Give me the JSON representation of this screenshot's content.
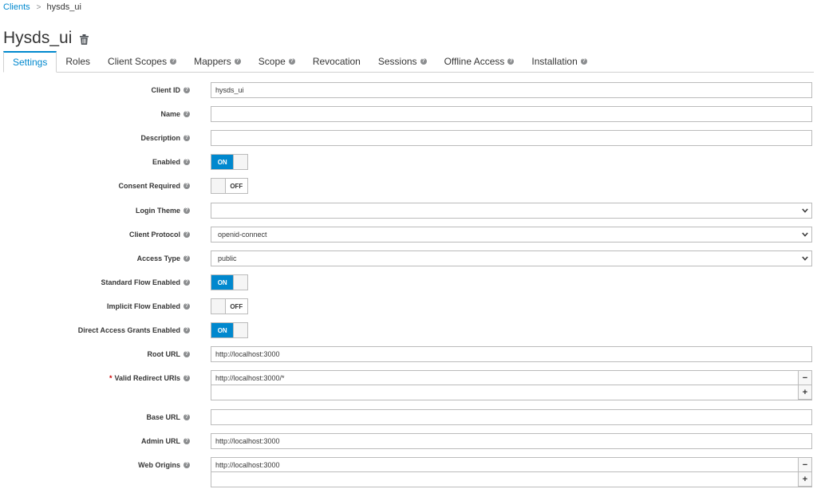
{
  "breadcrumb": {
    "parent": "Clients",
    "separator": ">",
    "current": "hysds_ui"
  },
  "title": "Hysds_ui",
  "tabs": [
    {
      "label": "Settings",
      "help": false
    },
    {
      "label": "Roles",
      "help": false
    },
    {
      "label": "Client Scopes",
      "help": true
    },
    {
      "label": "Mappers",
      "help": true
    },
    {
      "label": "Scope",
      "help": true
    },
    {
      "label": "Revocation",
      "help": false
    },
    {
      "label": "Sessions",
      "help": true
    },
    {
      "label": "Offline Access",
      "help": true
    },
    {
      "label": "Installation",
      "help": true
    }
  ],
  "form": {
    "client_id": {
      "label": "Client ID",
      "value": "hysds_ui"
    },
    "name": {
      "label": "Name",
      "value": ""
    },
    "description": {
      "label": "Description",
      "value": ""
    },
    "enabled": {
      "label": "Enabled",
      "state": "ON"
    },
    "consent_required": {
      "label": "Consent Required",
      "state": "OFF"
    },
    "login_theme": {
      "label": "Login Theme",
      "value": ""
    },
    "client_protocol": {
      "label": "Client Protocol",
      "value": "openid-connect"
    },
    "access_type": {
      "label": "Access Type",
      "value": "public"
    },
    "standard_flow": {
      "label": "Standard Flow Enabled",
      "state": "ON"
    },
    "implicit_flow": {
      "label": "Implicit Flow Enabled",
      "state": "OFF"
    },
    "direct_access": {
      "label": "Direct Access Grants Enabled",
      "state": "ON"
    },
    "root_url": {
      "label": "Root URL",
      "value": "http://localhost:3000"
    },
    "valid_redirect": {
      "label": "Valid Redirect URIs",
      "required_mark": "*",
      "values": [
        "http://localhost:3000/*",
        ""
      ]
    },
    "base_url": {
      "label": "Base URL",
      "value": ""
    },
    "admin_url": {
      "label": "Admin URL",
      "value": "http://localhost:3000"
    },
    "web_origins": {
      "label": "Web Origins",
      "values": [
        "http://localhost:3000",
        ""
      ]
    }
  },
  "icons": {
    "help": "question-circle-icon",
    "trash": "trash-icon",
    "chevron": "chevron-down-icon",
    "remove": "minus-icon",
    "add": "plus-icon"
  },
  "buttons": {
    "minus": "−",
    "plus": "+"
  },
  "colors": {
    "accent": "#0088ce",
    "border": "#bbbbbb",
    "required": "#cc0000"
  }
}
